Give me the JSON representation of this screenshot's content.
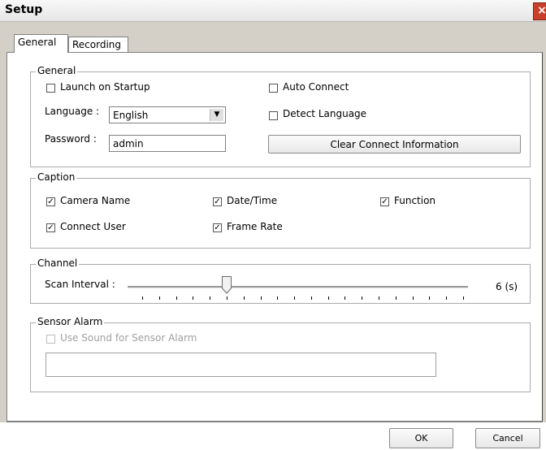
{
  "window": {
    "title": "Setup",
    "close_symbol": "×"
  },
  "tabs": [
    {
      "label": "General"
    },
    {
      "label": "Recording"
    }
  ],
  "general": {
    "title": "General",
    "launch_on_startup": {
      "label": "Launch on Startup",
      "checked": false
    },
    "auto_connect": {
      "label": "Auto Connect",
      "checked": false
    },
    "language_label": "Language :",
    "language_value": "English",
    "detect_language": {
      "label": "Detect Language",
      "checked": false
    },
    "password_label": "Password :",
    "password_value": "admin",
    "clear_button": "Clear Connect Information"
  },
  "caption": {
    "title": "Caption",
    "camera_name": {
      "label": "Camera Name",
      "checked": true
    },
    "date_time": {
      "label": "Date/Time",
      "checked": true
    },
    "function": {
      "label": "Function",
      "checked": true
    },
    "connect_user": {
      "label": "Connect User",
      "checked": true
    },
    "frame_rate": {
      "label": "Frame Rate",
      "checked": true
    }
  },
  "channel": {
    "title": "Channel",
    "scan_label": "Scan Interval :",
    "value_text": "6 (s)",
    "slider": {
      "min": 1,
      "max": 20,
      "value": 6,
      "ticks": 20
    }
  },
  "sensor": {
    "title": "Sensor Alarm",
    "use_sound": {
      "label": "Use Sound for Sensor Alarm",
      "checked": false
    },
    "path_value": ""
  },
  "footer": {
    "ok": "OK",
    "cancel": "Cancel"
  }
}
